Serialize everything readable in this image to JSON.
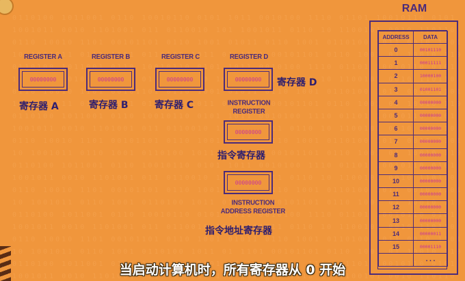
{
  "registers": {
    "a": {
      "label": "REGISTER A",
      "value": "00000000",
      "cn": "寄存器 A"
    },
    "b": {
      "label": "REGISTER B",
      "value": "00000000",
      "cn": "寄存器 B"
    },
    "c": {
      "label": "REGISTER C",
      "value": "00000000",
      "cn": "寄存器 C"
    },
    "d": {
      "label": "REGISTER D",
      "value": "00000000",
      "cn": "寄存器 D"
    },
    "ir": {
      "label": "INSTRUCTION REGISTER",
      "value": "00000000",
      "cn": "指令寄存器"
    },
    "iar": {
      "label": "INSTRUCTION ADDRESS REGISTER",
      "value": "00000000",
      "cn": "指令地址寄存器"
    }
  },
  "ram": {
    "title": "RAM",
    "headers": {
      "address": "ADDRESS",
      "data": "DATA"
    },
    "rows": [
      {
        "address": "0",
        "data": "00101110"
      },
      {
        "address": "1",
        "data": "00011111"
      },
      {
        "address": "2",
        "data": "10000100"
      },
      {
        "address": "3",
        "data": "01001101"
      },
      {
        "address": "4",
        "data": "00000000"
      },
      {
        "address": "5",
        "data": "00000000"
      },
      {
        "address": "6",
        "data": "00000000"
      },
      {
        "address": "7",
        "data": "00000000"
      },
      {
        "address": "8",
        "data": "00000000"
      },
      {
        "address": "9",
        "data": "00000000"
      },
      {
        "address": "10",
        "data": "00000000"
      },
      {
        "address": "11",
        "data": "00000000"
      },
      {
        "address": "12",
        "data": "00000000"
      },
      {
        "address": "13",
        "data": "00000000"
      },
      {
        "address": "14",
        "data": "00000011"
      },
      {
        "address": "15",
        "data": "00001110"
      }
    ],
    "more": "..."
  },
  "subtitle": "当启动计算机时，所有寄存器从 0 开始",
  "colors": {
    "background": "#f0963c",
    "outline": "#4a2a7a",
    "bits": "#c8359a",
    "chinese_text": "#2e1e6e"
  }
}
